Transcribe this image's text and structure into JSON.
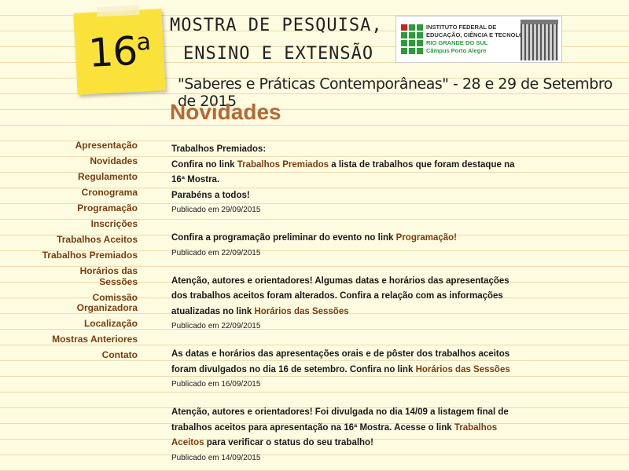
{
  "header": {
    "sticky_number": "16",
    "sticky_sup": "a",
    "title_line1": "MOSTRA DE PESQUISA,",
    "title_line2": "ENSINO E EXTENSÃO",
    "subtitle": "\"Saberes e Práticas Contemporâneas\" - 28 e 29 de Setembro de 2015",
    "logo": {
      "line1": "INSTITUTO FEDERAL DE",
      "line2": "EDUCAÇÃO, CIÊNCIA E TECNOLOGIA",
      "line3": "RIO GRANDE DO SUL",
      "line4": "Câmpus Porto Alegre"
    }
  },
  "page_title": "Novidades",
  "sidebar": {
    "items": [
      {
        "label": "Apresentação"
      },
      {
        "label": "Novidades"
      },
      {
        "label": "Regulamento"
      },
      {
        "label": "Cronograma"
      },
      {
        "label": "Programação"
      },
      {
        "label": "Inscrições"
      },
      {
        "label": "Trabalhos Aceitos"
      },
      {
        "label": "Trabalhos Premiados"
      },
      {
        "label": "Horários das Sessões"
      },
      {
        "label": "Comissão Organizadora"
      },
      {
        "label": "Localização"
      },
      {
        "label": "Mostras Anteriores"
      },
      {
        "label": "Contato"
      }
    ]
  },
  "posts": [
    {
      "heading": "Trabalhos Premiados:",
      "before": "Confira no link ",
      "link": "Trabalhos Premiados",
      "after": " a lista de trabalhos que foram destaque na 16ª Mostra.",
      "extra": "Parabéns a todos!",
      "date": "Publicado em 29/09/2015"
    },
    {
      "before": "Confira a programação preliminar do evento no link ",
      "link": "Programação!",
      "date": "Publicado em 22/09/2015"
    },
    {
      "before": "Atenção, autores e orientadores! Algumas datas e horários das apresentações dos trabalhos aceitos foram alterados. Confira a relação com as informações atualizadas no link ",
      "link": "Horários das Sessões",
      "date": "Publicado em 22/09/2015"
    },
    {
      "before": "As datas e horários das apresentações orais e de pôster dos trabalhos aceitos foram divulgados no dia 16 de setembro. Confira no link ",
      "link": "Horários das Sessões",
      "date": "Publicado em 16/09/2015"
    },
    {
      "before": "Atenção, autores e orientadores! Foi divulgada no dia 14/09 a listagem final de trabalhos aceitos para apresentação na 16ª Mostra. Acesse o link ",
      "link": "Trabalhos Aceitos",
      "after": " para verificar o status do seu trabalho!",
      "date": "Publicado em 14/09/2015"
    }
  ],
  "colors": {
    "background": "#fdfbe0",
    "page_title": "#b56836",
    "link": "#7a3e10",
    "sticky_note": "#fbe23b"
  }
}
